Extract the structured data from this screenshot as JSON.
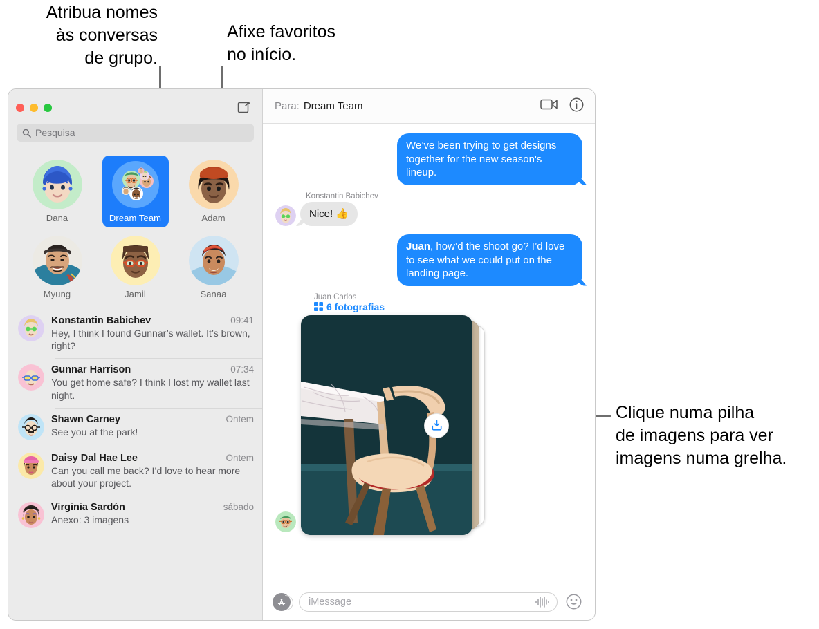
{
  "callouts": [
    {
      "id": "group-names",
      "text": "Atribua nomes\nàs conversas\nde grupo."
    },
    {
      "id": "pin-favorites",
      "text": "Afixe favoritos\nno início."
    },
    {
      "id": "photo-stack",
      "text": "Clique numa pilha\nde imagens para ver\nimagens numa grelha."
    }
  ],
  "window": {
    "traffic_lights": [
      "close",
      "minimize",
      "zoom"
    ],
    "compose_icon": "compose-icon"
  },
  "sidebar": {
    "search": {
      "placeholder": "Pesquisa",
      "icon": "search-icon"
    },
    "pinned": [
      {
        "name": "Dana",
        "selected": false
      },
      {
        "name": "Dream Team",
        "selected": true
      },
      {
        "name": "Adam",
        "selected": false
      },
      {
        "name": "Myung",
        "selected": false
      },
      {
        "name": "Jamil",
        "selected": false
      },
      {
        "name": "Sanaa",
        "selected": false
      }
    ],
    "conversations": [
      {
        "name": "Konstantin Babichev",
        "time": "09:41",
        "preview": "Hey, I think I found Gunnar’s wallet. It’s brown, right?"
      },
      {
        "name": "Gunnar Harrison",
        "time": "07:34",
        "preview": "You get home safe? I think I lost my wallet last night."
      },
      {
        "name": "Shawn Carney",
        "time": "Ontem",
        "preview": "See you at the park!"
      },
      {
        "name": "Daisy Dal Hae Lee",
        "time": "Ontem",
        "preview": "Can you call me back? I’d love to hear more about your project."
      },
      {
        "name": "Virginia Sardón",
        "time": "sábado",
        "preview": "Anexo:  3 imagens"
      }
    ]
  },
  "chat": {
    "header": {
      "to_label": "Para:",
      "recipient": "Dream Team",
      "facetime_icon": "video-camera-icon",
      "info_icon": "info-circle-icon"
    },
    "messages": [
      {
        "kind": "out",
        "text": "We’ve been trying to get designs together for the new season's lineup."
      },
      {
        "kind": "in",
        "sender": "Konstantin Babichev",
        "text": "Nice!  👍"
      },
      {
        "kind": "out",
        "mention": "Juan",
        "text": ", how’d the shoot go? I’d love to see what we could put on the landing page."
      }
    ],
    "attachment": {
      "sender": "Juan Carlos",
      "count_label": "6 fotografias",
      "grid_icon": "grid-2x2-icon",
      "download_icon": "download-icon"
    },
    "composer": {
      "apps_icon": "app-store-icon",
      "placeholder": "iMessage",
      "audio_icon": "audio-waveform-icon",
      "emoji_icon": "smiley-icon"
    }
  },
  "colors": {
    "accent_blue": "#1d8aff",
    "pin_selected": "#1d7dfb",
    "bubble_grey": "#e6e6e6",
    "sidebar_bg": "#ebebeb"
  }
}
